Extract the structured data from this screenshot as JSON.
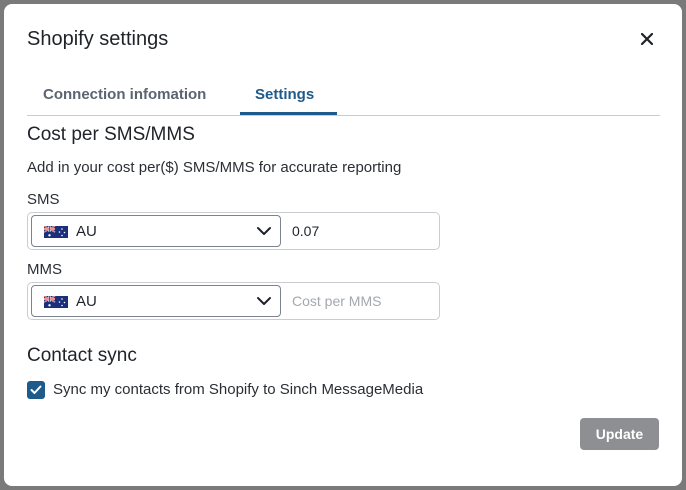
{
  "modal": {
    "title": "Shopify settings",
    "close_icon": "close-icon"
  },
  "tabs": [
    {
      "label": "Connection infomation",
      "active": false
    },
    {
      "label": "Settings",
      "active": true
    }
  ],
  "cost": {
    "heading": "Cost per SMS/MMS",
    "description": "Add in your cost per($) SMS/MMS for accurate reporting",
    "sms": {
      "label": "SMS",
      "country": "AU",
      "flag_icon": "australia-flag-icon",
      "value": "0.07",
      "placeholder": ""
    },
    "mms": {
      "label": "MMS",
      "country": "AU",
      "flag_icon": "australia-flag-icon",
      "value": "",
      "placeholder": "Cost per MMS"
    }
  },
  "contact_sync": {
    "heading": "Contact sync",
    "checkbox_label": "Sync my contacts from Shopify to Sinch MessageMedia",
    "checked": true
  },
  "actions": {
    "update_label": "Update"
  },
  "colors": {
    "accent": "#1e5a8a",
    "disabled_button": "#8d8f92"
  }
}
